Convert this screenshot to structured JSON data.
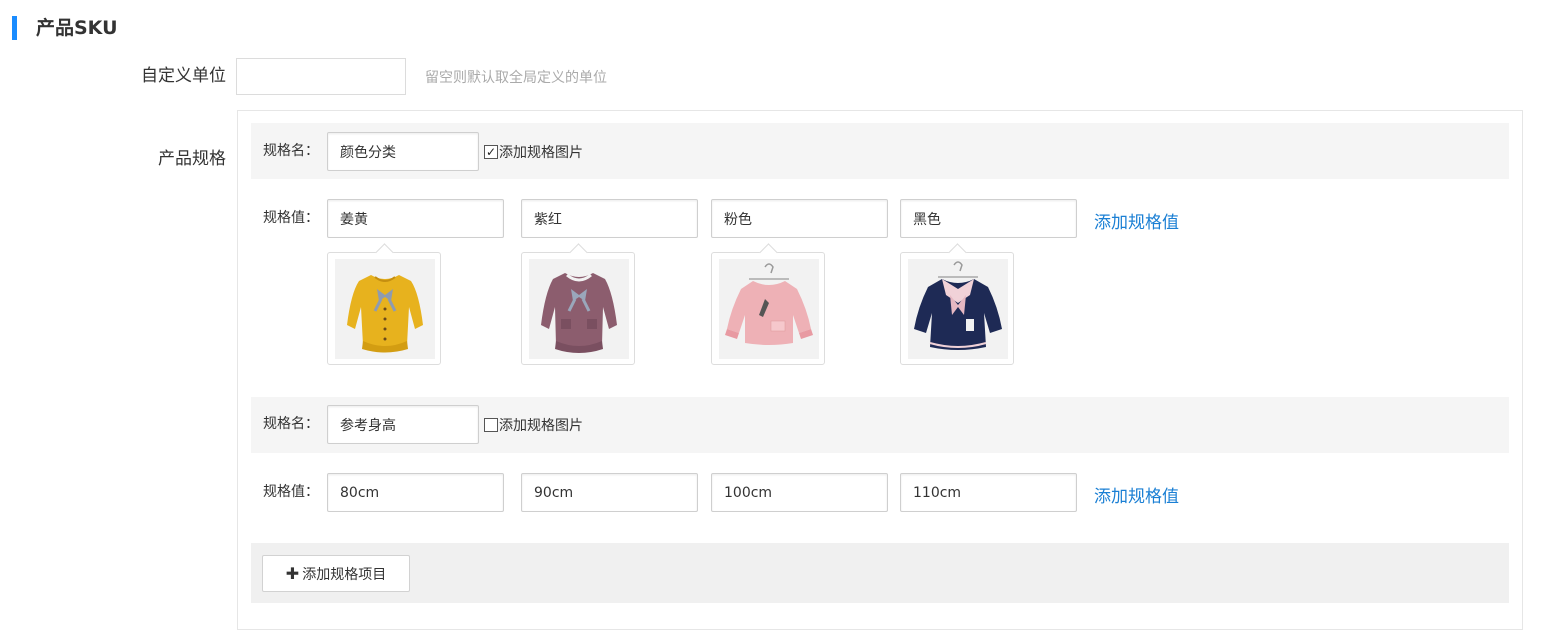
{
  "section": {
    "title": "产品SKU"
  },
  "unit": {
    "label": "自定义单位",
    "value": "",
    "hint": "留空则默认取全局定义的单位"
  },
  "spec": {
    "label": "产品规格",
    "name_label": "规格名：",
    "value_label": "规格值：",
    "add_image_label": "添加规格图片",
    "add_value_label": "添加规格值",
    "add_item_label": "添加规格项目",
    "groups": [
      {
        "name": "颜色分类",
        "add_image_checked": true,
        "values": [
          "姜黄",
          "紫红",
          "粉色",
          "黑色"
        ]
      },
      {
        "name": "参考身高",
        "add_image_checked": false,
        "values": [
          "80cm",
          "90cm",
          "100cm",
          "110cm"
        ]
      }
    ]
  },
  "icons": {
    "check": "checkmark-icon",
    "plus": "plus-icon"
  },
  "colors": {
    "accent": "#1a8cff",
    "link": "#1a7fd4",
    "swatch_yellow": "#e7b21e",
    "swatch_purple": "#8c5d6e",
    "swatch_pink": "#eeb1b6",
    "swatch_navy": "#1e2a55"
  }
}
